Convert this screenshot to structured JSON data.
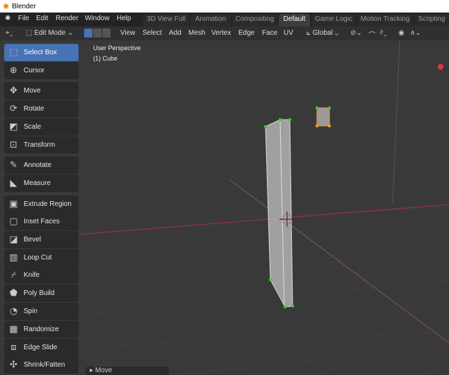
{
  "window": {
    "title": "Blender"
  },
  "menu": [
    "File",
    "Edit",
    "Render",
    "Window",
    "Help"
  ],
  "workspaces": [
    {
      "label": "3D View Full"
    },
    {
      "label": "Animation"
    },
    {
      "label": "Compositing"
    },
    {
      "label": "Default",
      "active": true
    },
    {
      "label": "Game Logic"
    },
    {
      "label": "Motion Tracking"
    },
    {
      "label": "Scripting"
    }
  ],
  "header": {
    "mode": "Edit Mode",
    "menus": [
      "View",
      "Select",
      "Add",
      "Mesh",
      "Vertex",
      "Edge",
      "Face",
      "UV"
    ],
    "orientation": "Global"
  },
  "viewport": {
    "perspective": "User Perspective",
    "object": "(1) Cube"
  },
  "tools": [
    {
      "label": "Select Box",
      "icon": "select-box-icon",
      "active": true
    },
    {
      "label": "Cursor",
      "icon": "cursor-icon"
    },
    {
      "label": "Move",
      "icon": "move-icon"
    },
    {
      "label": "Rotate",
      "icon": "rotate-icon"
    },
    {
      "label": "Scale",
      "icon": "scale-icon"
    },
    {
      "label": "Transform",
      "icon": "transform-icon"
    },
    {
      "label": "Annotate",
      "icon": "annotate-icon"
    },
    {
      "label": "Measure",
      "icon": "measure-icon"
    },
    {
      "label": "Extrude Region",
      "icon": "extrude-icon"
    },
    {
      "label": "Inset Faces",
      "icon": "inset-icon"
    },
    {
      "label": "Bevel",
      "icon": "bevel-icon"
    },
    {
      "label": "Loop Cut",
      "icon": "loop-cut-icon"
    },
    {
      "label": "Knife",
      "icon": "knife-icon"
    },
    {
      "label": "Poly Build",
      "icon": "poly-build-icon"
    },
    {
      "label": "Spin",
      "icon": "spin-icon"
    },
    {
      "label": "Randomize",
      "icon": "randomize-icon"
    },
    {
      "label": "Edge Slide",
      "icon": "edge-slide-icon"
    },
    {
      "label": "Shrink/Fatten",
      "icon": "shrink-fatten-icon"
    }
  ],
  "last_operator": "Move",
  "colors": {
    "accent": "#4772b3",
    "vertex_selected": "#3ec83e",
    "vertex_active": "#f29a1a"
  }
}
